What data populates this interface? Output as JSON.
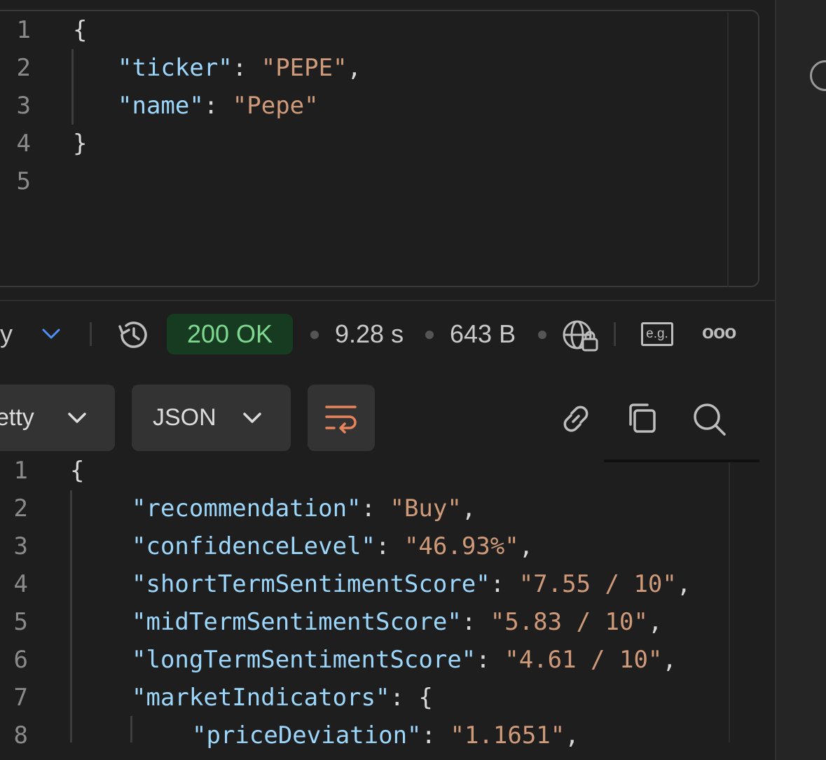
{
  "request_body": {
    "line_numbers": [
      "1",
      "2",
      "3",
      "4",
      "5"
    ],
    "open_brace": "{",
    "close_brace": "}",
    "fields": [
      {
        "key": "\"ticker\"",
        "value": "\"PEPE\"",
        "trail": ","
      },
      {
        "key": "\"name\"",
        "value": "\"Pepe\"",
        "trail": ""
      }
    ]
  },
  "status_bar": {
    "view_fragment": "y",
    "status": "200 OK",
    "time": "9.28 s",
    "size": "643 B",
    "examples_label": "e.g.",
    "more_label": "ooo"
  },
  "toolbar": {
    "view_mode": "etty",
    "format": "JSON"
  },
  "response_body": {
    "line_numbers": [
      "1",
      "2",
      "3",
      "4",
      "5",
      "6",
      "7",
      "8"
    ],
    "open_brace": "{",
    "fields": [
      {
        "key": "\"recommendation\"",
        "value": "\"Buy\"",
        "trail": ","
      },
      {
        "key": "\"confidenceLevel\"",
        "value": "\"46.93%\"",
        "trail": ","
      },
      {
        "key": "\"shortTermSentimentScore\"",
        "value": "\"7.55 / 10\"",
        "trail": ","
      },
      {
        "key": "\"midTermSentimentScore\"",
        "value": "\"5.83 / 10\"",
        "trail": ","
      },
      {
        "key": "\"longTermSentimentScore\"",
        "value": "\"4.61 / 10\"",
        "trail": ","
      },
      {
        "key": "\"marketIndicators\"",
        "value": "{",
        "trail": ""
      }
    ],
    "nested_fields": [
      {
        "key": "\"priceDeviation\"",
        "value": "\"1.1651\"",
        "trail": ","
      }
    ]
  },
  "colors": {
    "key": "#9cd6fb",
    "string": "#cf9a79",
    "status_ok_bg": "#173b21",
    "status_ok_text": "#7fd88f",
    "accent_blue": "#4f8ff7",
    "wrap_orange": "#e8835a"
  },
  "icons": [
    "info-icon",
    "chevron-down-icon",
    "history-icon",
    "globe-lock-icon",
    "examples-icon",
    "more-icon",
    "wrap-lines-icon",
    "link-icon",
    "copy-icon",
    "search-icon"
  ]
}
